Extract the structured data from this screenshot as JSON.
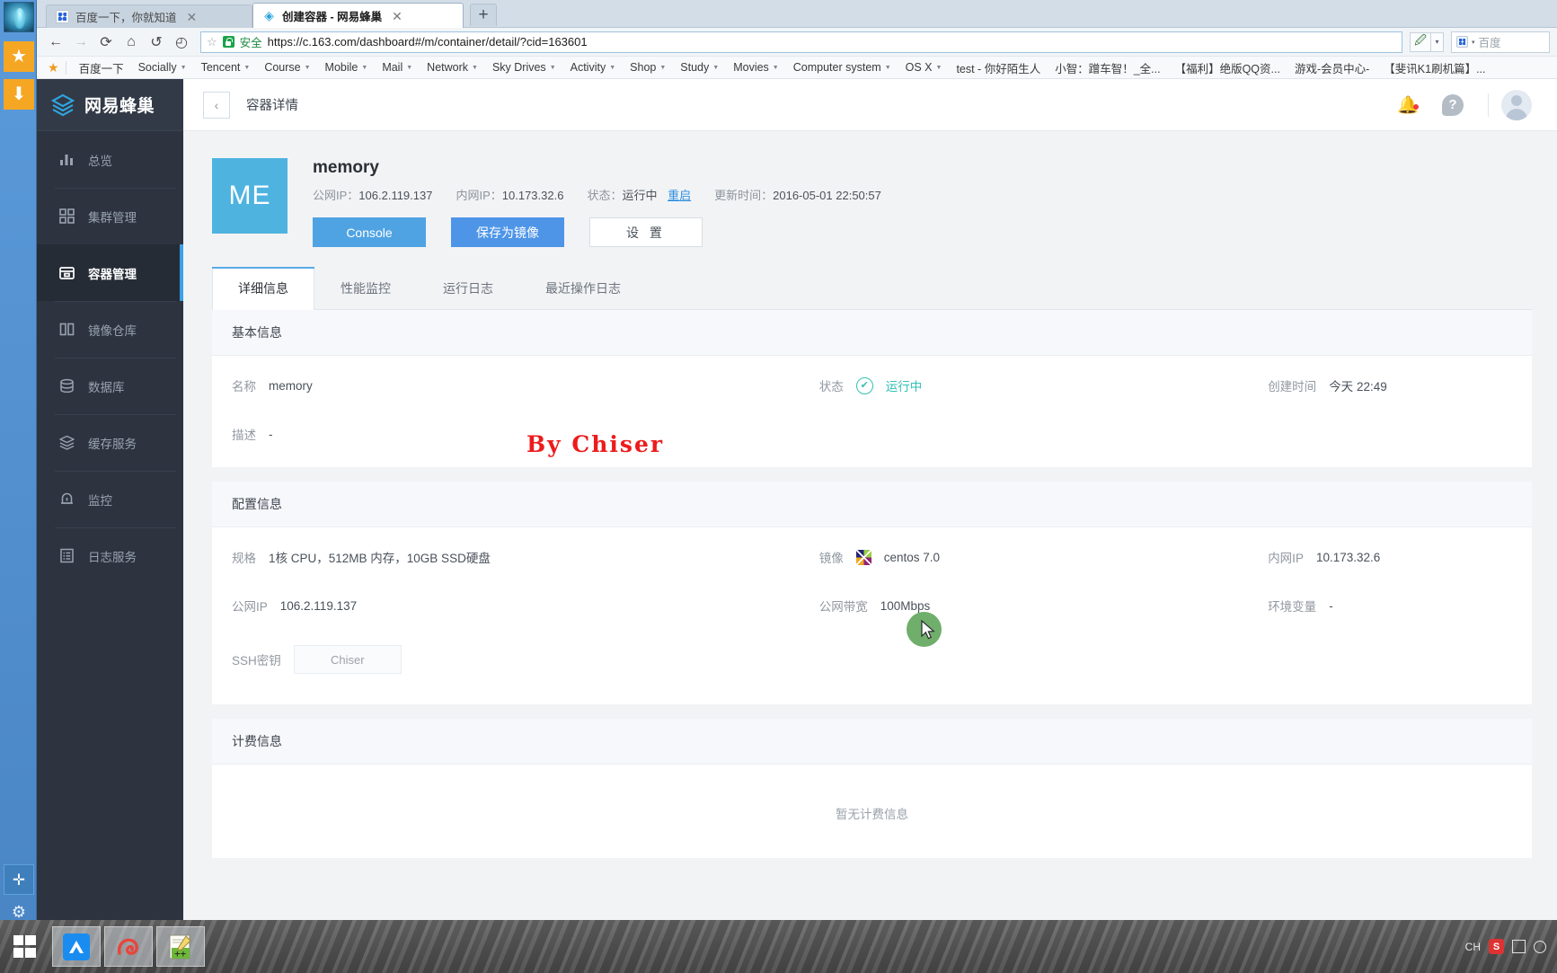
{
  "browser": {
    "tabs": [
      {
        "title": "百度一下，你就知道",
        "icon": "baidu-favicon",
        "active": false
      },
      {
        "title": "创建容器 - 网易蜂巢",
        "icon": "hive-favicon",
        "active": true
      }
    ],
    "new_tab_label": "+",
    "close_label": "✕",
    "nav": {
      "back": "←",
      "forward": "→",
      "reload": "⟳",
      "home": "⌂",
      "undo": "↺",
      "history": "◴"
    },
    "omnibox": {
      "star": "☆",
      "security_label": "安全",
      "url": "https://c.163.com/dashboard#/m/container/detail/?cid=163601"
    },
    "search": {
      "placeholder": "百度"
    },
    "bookmarks": [
      {
        "label": "百度一下",
        "caret": false
      },
      {
        "label": "Socially",
        "caret": true
      },
      {
        "label": "Tencent",
        "caret": true
      },
      {
        "label": "Course",
        "caret": true
      },
      {
        "label": "Mobile",
        "caret": true
      },
      {
        "label": "Mail",
        "caret": true
      },
      {
        "label": "Network",
        "caret": true
      },
      {
        "label": "Sky Drives",
        "caret": true
      },
      {
        "label": "Activity",
        "caret": true
      },
      {
        "label": "Shop",
        "caret": true
      },
      {
        "label": "Study",
        "caret": true
      },
      {
        "label": "Movies",
        "caret": true
      },
      {
        "label": "Computer system",
        "caret": true
      },
      {
        "label": "OS X",
        "caret": true
      },
      {
        "label": "test - 你好陌生人",
        "caret": false
      },
      {
        "label": "小智：蹭车智！_全...",
        "caret": false
      },
      {
        "label": "【福利】绝版QQ资...",
        "caret": false
      },
      {
        "label": "游戏-会员中心-",
        "caret": false
      },
      {
        "label": "【斐讯K1刷机篇】...",
        "caret": false
      }
    ]
  },
  "sidebar": {
    "brand": "网易蜂巢",
    "items": [
      {
        "label": "总览",
        "icon": "chart-bars-icon",
        "active": false
      },
      {
        "label": "集群管理",
        "icon": "grid-squares-icon",
        "active": false
      },
      {
        "label": "容器管理",
        "icon": "container-box-icon",
        "active": true
      },
      {
        "label": "镜像仓库",
        "icon": "columns-icon",
        "active": false
      },
      {
        "label": "数据库",
        "icon": "database-icon",
        "active": false
      },
      {
        "label": "缓存服务",
        "icon": "layers-icon",
        "active": false
      },
      {
        "label": "监控",
        "icon": "bell-monitor-icon",
        "active": false
      },
      {
        "label": "日志服务",
        "icon": "list-document-icon",
        "active": false
      }
    ]
  },
  "topbar": {
    "back_icon": "chevron-left-icon",
    "breadcrumb": "容器详情",
    "notification_icon": "bell-icon",
    "help_icon": "help-icon",
    "avatar_icon": "user-avatar-icon"
  },
  "header": {
    "thumb_text": "ME",
    "title": "memory",
    "public_ip_label": "公网IP：",
    "public_ip_value": "106.2.119.137",
    "private_ip_label": "内网IP：",
    "private_ip_value": "10.173.32.6",
    "status_label": "状态：",
    "status_value": "运行中",
    "restart_link": "重启",
    "updated_label": "更新时间：",
    "updated_value": "2016-05-01 22:50:57",
    "buttons": {
      "console": "Console",
      "save_image": "保存为镜像",
      "settings": "设 置"
    }
  },
  "tabs": [
    {
      "label": "详细信息",
      "selected": true
    },
    {
      "label": "性能监控",
      "selected": false
    },
    {
      "label": "运行日志",
      "selected": false
    },
    {
      "label": "最近操作日志",
      "selected": false
    }
  ],
  "watermark": "By Chiser",
  "basic_info": {
    "title": "基本信息",
    "name_label": "名称",
    "name_value": "memory",
    "status_label": "状态",
    "status_value": "运行中",
    "status_icon": "check-circle-icon",
    "created_label": "创建时间",
    "created_value": "今天 22:49",
    "desc_label": "描述",
    "desc_value": "-"
  },
  "config_info": {
    "title": "配置信息",
    "spec_label": "规格",
    "spec_value": "1核 CPU，512MB 内存，10GB SSD硬盘",
    "image_label": "镜像",
    "image_value": "centos 7.0",
    "image_icon": "centos-icon",
    "private_ip_label": "内网IP",
    "private_ip_value": "10.173.32.6",
    "public_ip_label": "公网IP",
    "public_ip_value": "106.2.119.137",
    "bandwidth_label": "公网带宽",
    "bandwidth_value": "100Mbps",
    "env_label": "环境变量",
    "env_value": "-",
    "ssh_label": "SSH密钥",
    "ssh_value": "Chiser"
  },
  "billing_info": {
    "title": "计费信息",
    "empty_text": "暂无计费信息"
  },
  "taskbar": {
    "start_icon": "windows-start-icon",
    "apps": [
      {
        "name": "maxthon-icon"
      },
      {
        "name": "snail-browser-icon"
      },
      {
        "name": "notepad-plus-plus-icon"
      }
    ],
    "tray": {
      "ime": "CH",
      "s_badge": "S"
    }
  },
  "colors": {
    "accent": "#4fa3e3",
    "sidebar_bg": "#2d3440",
    "status_green": "#32c1b6",
    "watermark_red": "#ec1c1c"
  }
}
